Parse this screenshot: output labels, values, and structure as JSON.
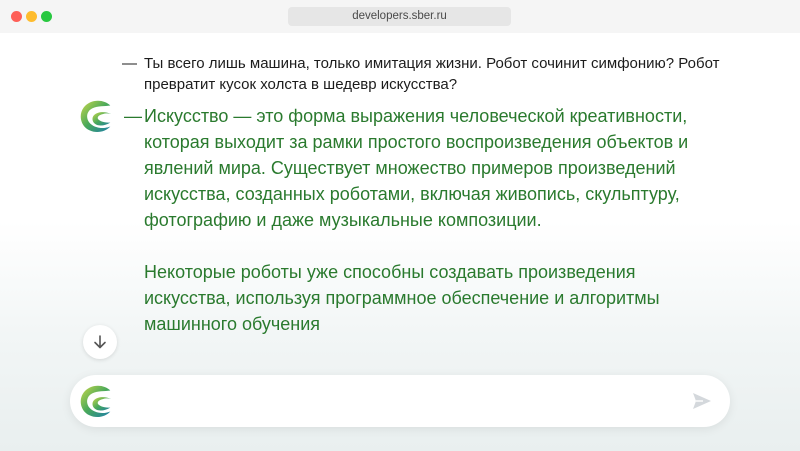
{
  "browser": {
    "url": "developers.sber.ru"
  },
  "chat": {
    "user_message": {
      "dash": "—",
      "text": "Ты всего лишь машина, только имитация жизни. Робот сочинит симфонию? Робот превратит кусок холста в шедевр искусства?"
    },
    "bot_message": {
      "dash": "—",
      "paragraphs": [
        "Искусство — это форма выражения человеческой креативности, которая выходит за рамки простого воспроизведения объектов и явлений мира. Существует множество примеров произведений искусства, созданных роботами, включая живопись, скульптуру, фотографию и даже музыкальные композиции.",
        "Некоторые роботы уже способны создавать произведения искусства, используя программное обеспечение и алгоритмы машинного обучения"
      ]
    }
  },
  "input": {
    "value": "",
    "placeholder": ""
  },
  "icons": {
    "bot_avatar": "sber-logo-icon",
    "scroll_down": "arrow-down-icon",
    "send": "send-icon"
  },
  "colors": {
    "bot_text": "#2a7a2e",
    "user_text": "#1c1c1c",
    "close_dot": "#fe5f57",
    "minimize_dot": "#febc2e",
    "maximize_dot": "#28c840"
  }
}
